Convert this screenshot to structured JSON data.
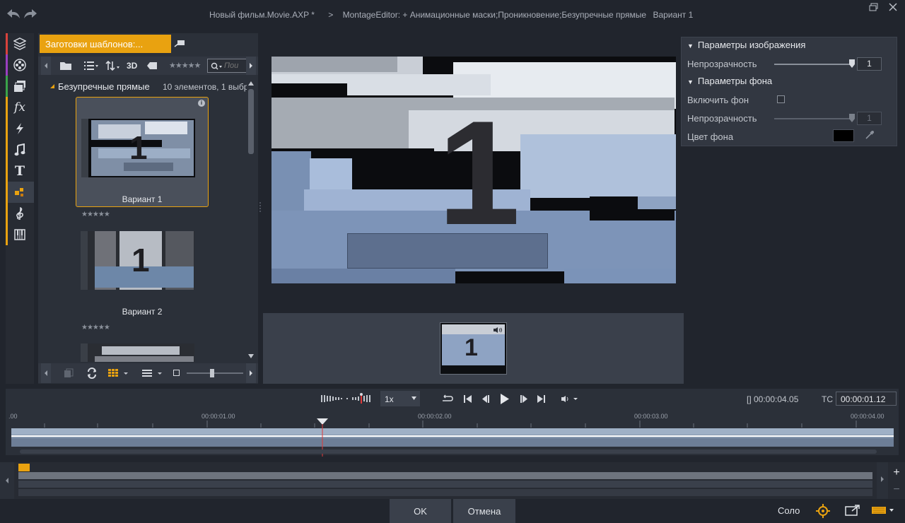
{
  "titlebar": {
    "project": "Новый фильм.Movie.AXP *",
    "separator": ">",
    "editor": "MontageEditor: + Анимационные маски;Проникновение;Безупречные прямые",
    "variant": "Вариант 1"
  },
  "rail": {
    "icons": [
      "layers-icon",
      "film-reel-icon",
      "media-stack-icon",
      "fx-icon",
      "lightning-icon",
      "music-note-icon",
      "text-icon",
      "montage-icon",
      "treble-clef-icon",
      "piano-icon"
    ],
    "fx_glyph": "fx",
    "text_glyph": "T"
  },
  "library": {
    "tab_label": "Заготовки шаблонов:...",
    "toolbar": {
      "label_3d": "3D",
      "search_placeholder": "Пои"
    },
    "group": {
      "name": "Безупречные прямые",
      "count": "10 элементов, 1 выбр"
    },
    "items": [
      {
        "name": "Вариант 1",
        "stars": "★★★★★",
        "number": "1",
        "selected": true
      },
      {
        "name": "Вариант 2",
        "stars": "★★★★★",
        "number": "1",
        "selected": false
      }
    ]
  },
  "preview": {
    "number": "1",
    "filmstrip_number": "1"
  },
  "params": {
    "image_section": "Параметры изображения",
    "opacity_label": "Непрозрачность",
    "opacity_value": "1",
    "bg_section": "Параметры фона",
    "enable_bg_label": "Включить фон",
    "bg_opacity_label": "Непрозрачность",
    "bg_opacity_value": "1",
    "bg_color_label": "Цвет фона",
    "bg_color": "#000000"
  },
  "transport": {
    "speed": "1x",
    "duration": "[] 00:00:04.05",
    "tc_label": "TC",
    "tc_value": "00:00:01.12"
  },
  "ruler": {
    "labels": [
      ".00",
      "00:00:01.00",
      "00:00:02.00",
      "00:00:03.00",
      "00:00:04.00"
    ]
  },
  "footer": {
    "ok": "OK",
    "cancel": "Отмена",
    "solo": "Соло"
  },
  "colors": {
    "accent": "#e9a210",
    "playhead": "#e03a3a",
    "panel": "#2b3039"
  }
}
